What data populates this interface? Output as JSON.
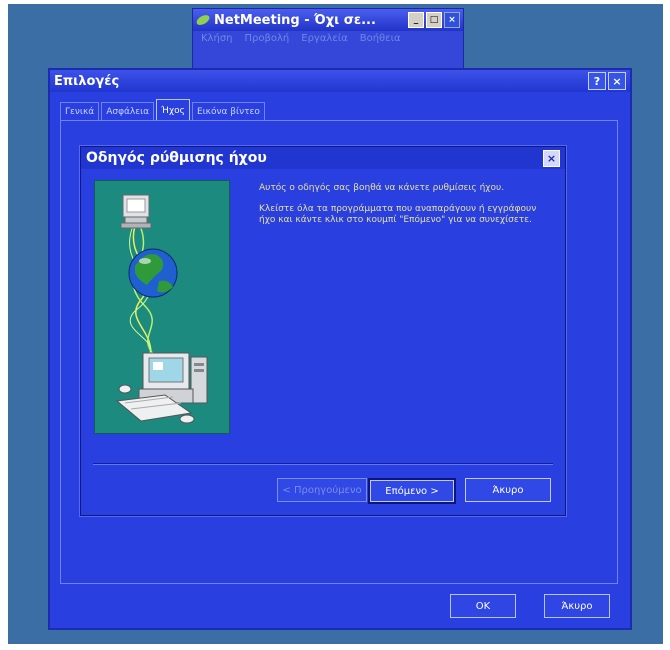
{
  "netmeeting": {
    "title": "NetMeeting - Όχι σε...",
    "menu": [
      "Κλήση",
      "Προβολή",
      "Εργαλεία",
      "Βοήθεια"
    ],
    "controls": {
      "minimize": "_",
      "maximize": "□",
      "close": "×"
    }
  },
  "options_dialog": {
    "title": "Επιλογές",
    "help_label": "?",
    "close_label": "×",
    "tabs": [
      "Γενικά",
      "Ασφάλεια",
      "Ήχος",
      "Εικόνα βίντεο"
    ],
    "active_tab": 2,
    "ok_label": "OK",
    "cancel_label": "Άκυρο"
  },
  "wizard": {
    "title": "Οδηγός ρύθμισης ήχου",
    "close_label": "×",
    "paragraph1": "Αυτός ο οδηγός σας βοηθά να κάνετε ρυθμίσεις ήχου.",
    "paragraph2": "Κλείστε όλα τα προγράμματα που αναπαράγουν ή εγγράφουν ήχο και κάντε κλικ στο κουμπί \"Επόμενο\" για να συνεχίσετε.",
    "back_label": "< Προηγούμενο",
    "next_label": "Επόμενο >",
    "cancel_label": "Άκυρο"
  },
  "colors": {
    "desktop": "#3a6ea5",
    "window": "#2a3fe0",
    "wizard_image_bg": "#1c8a7e",
    "wizard_text": "#e4e0a0"
  }
}
